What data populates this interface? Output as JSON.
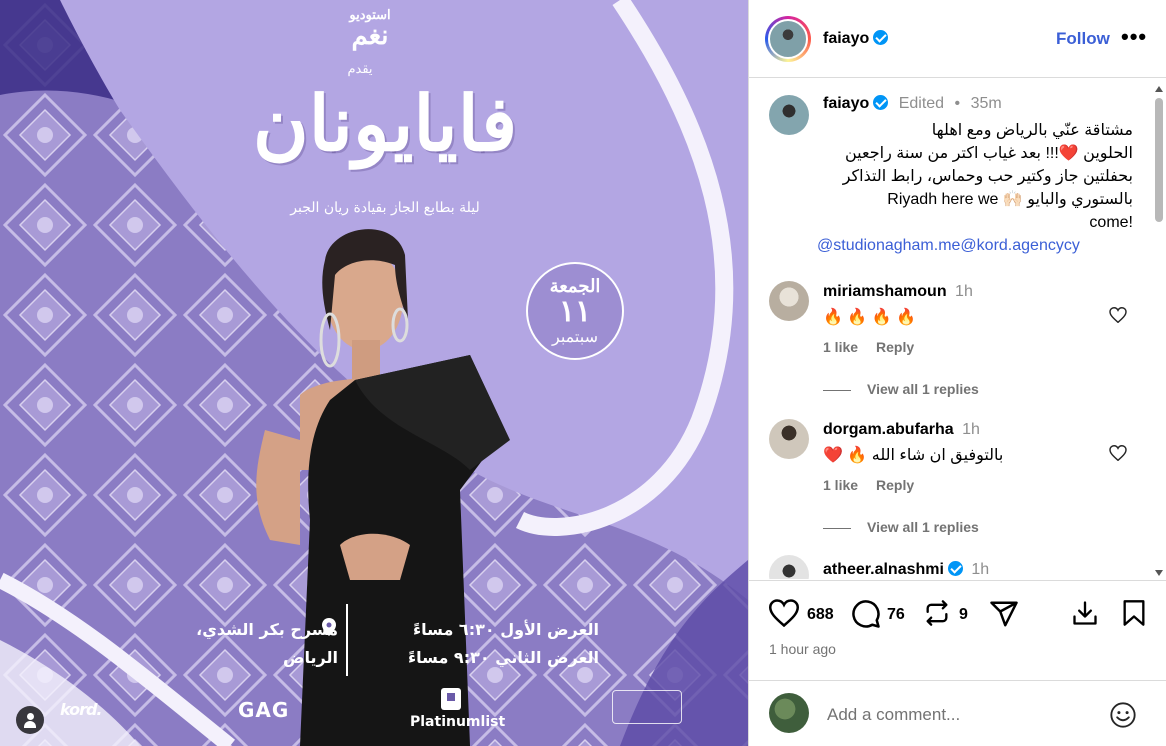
{
  "media": {
    "studio_logo": "استوديو",
    "studio_logo_sub": "نغم",
    "presents": "يقدم",
    "event_title": "فايايونان",
    "event_subtitle": "ليلة بطابع الجاز بقيادة ريان الجبر",
    "date_day": "الجمعة",
    "date_num": "١١",
    "date_month": "سبتمبر",
    "show1": "العرض الأول ٦:٣٠ مساءً",
    "show2": "العرض الثاني ٩:٣٠ مساءً",
    "venue1": "مسرح بكر الشدي،",
    "venue2": "الرياض",
    "sponsor_kord": "kord.",
    "sponsor_gag": "GAG",
    "sponsor_platinum": "Platinumlist"
  },
  "header": {
    "username": "faiayo",
    "follow_label": "Follow",
    "more_label": "•••"
  },
  "caption": {
    "username": "faiayo",
    "edited_label": "Edited",
    "separator": "•",
    "time": "35m",
    "text_line1": "مشتاقة عنّي بالرياض ومع اهلها",
    "text_line2": "الحلوين ❤️!!! بعد غياب اكتر من سنة راجعين",
    "text_line3": "بحفلتين جاز وكتير حب وحماس، رابط التذاكر",
    "text_line4": "بالستوري والبايو 🙌🏻 Riyadh here we",
    "text_line5": "!come",
    "tags": "@studionagham.me@kord.agencycy"
  },
  "comments": [
    {
      "username": "miriamshamoun",
      "time": "1h",
      "text": "🔥 🔥 🔥 🔥",
      "likes": "1 like",
      "reply": "Reply",
      "view_all": "View all 1 replies"
    },
    {
      "username": "dorgam.abufarha",
      "time": "1h",
      "text": "بالتوفيق ان شاء الله 🔥 ❤️",
      "likes": "1 like",
      "reply": "Reply",
      "view_all": "View all 1 replies"
    },
    {
      "username": "atheer.alnashmi",
      "time": "1h"
    }
  ],
  "actions": {
    "likes_count": "688",
    "comments_count": "76",
    "reposts_count": "9",
    "posted_ago": "1 hour ago"
  },
  "add_comment": {
    "placeholder": "Add a comment..."
  }
}
